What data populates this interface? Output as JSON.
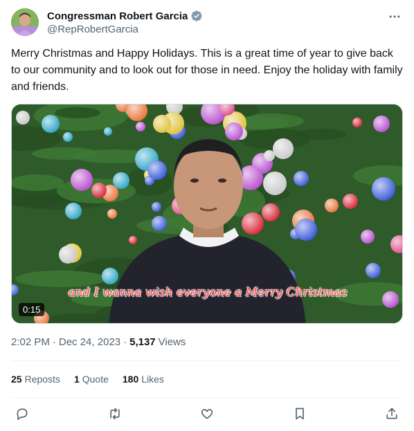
{
  "author": {
    "display_name": "Congressman Robert Garcia",
    "handle": "@RepRobertGarcia",
    "verified_icon": "verified-badge-icon",
    "avatar_icon": "profile-avatar"
  },
  "tweet": {
    "text": "Merry Christmas and Happy Holidays. This is a great time of year to give back to our community and to look out for those in need. Enjoy the holiday with family and friends."
  },
  "media": {
    "caption": "and I wanna wish everyone a Merry Christmas",
    "duration": "0:15"
  },
  "meta": {
    "time": "2:02 PM",
    "separator": "·",
    "date": "Dec 24, 2023",
    "views_count": "5,137",
    "views_label": "Views"
  },
  "stats": {
    "reposts_count": "25",
    "reposts_label": "Reposts",
    "quotes_count": "1",
    "quotes_label": "Quote",
    "likes_count": "180",
    "likes_label": "Likes"
  },
  "actions": [
    "reply-icon",
    "repost-icon",
    "like-icon",
    "bookmark-icon",
    "share-icon"
  ],
  "colors": {
    "text_primary": "#0f1419",
    "text_secondary": "#536471",
    "verified_blue": "#829aab",
    "caption_red": "#ff4d4d"
  }
}
